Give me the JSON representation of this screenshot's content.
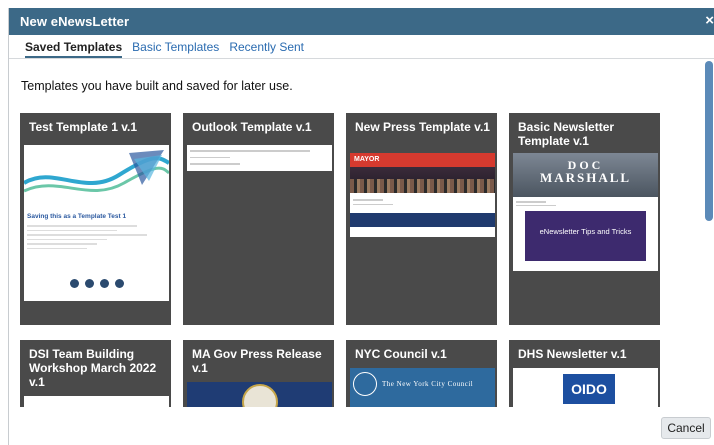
{
  "dialog": {
    "title": "New eNewsLetter",
    "close_glyph": "×"
  },
  "tabs": [
    {
      "label": "Saved Templates",
      "active": true
    },
    {
      "label": "Basic Templates",
      "active": false
    },
    {
      "label": "Recently Sent",
      "active": false
    }
  ],
  "intro": "Templates you have built and saved for later use.",
  "cards": [
    {
      "title": "Test Template 1 v.1",
      "preview_heading": "Saving this as a Template Test 1"
    },
    {
      "title": "Outlook Template v.1"
    },
    {
      "title": "New Press Template v.1",
      "preview_banner": "MAYOR"
    },
    {
      "title": "Basic Newsletter Template v.1",
      "preview_banner_top": "DOC",
      "preview_banner_bottom": "MARSHALL",
      "preview_feature": "eNewsletter Tips and Tricks"
    },
    {
      "title": "DSI Team Building Workshop March 2022 v.1"
    },
    {
      "title": "MA Gov Press Release v.1"
    },
    {
      "title": "NYC Council v.1",
      "preview_banner": "The New York City Council"
    },
    {
      "title": "DHS Newsletter v.1",
      "preview_logo": "OIDO"
    }
  ],
  "footer": {
    "cancel_label": "Cancel"
  },
  "colors": {
    "titlebar": "#3c6987",
    "card_bg": "#4a4a4a",
    "link": "#2a6bb0",
    "scroll_thumb": "#5b8ab8"
  }
}
